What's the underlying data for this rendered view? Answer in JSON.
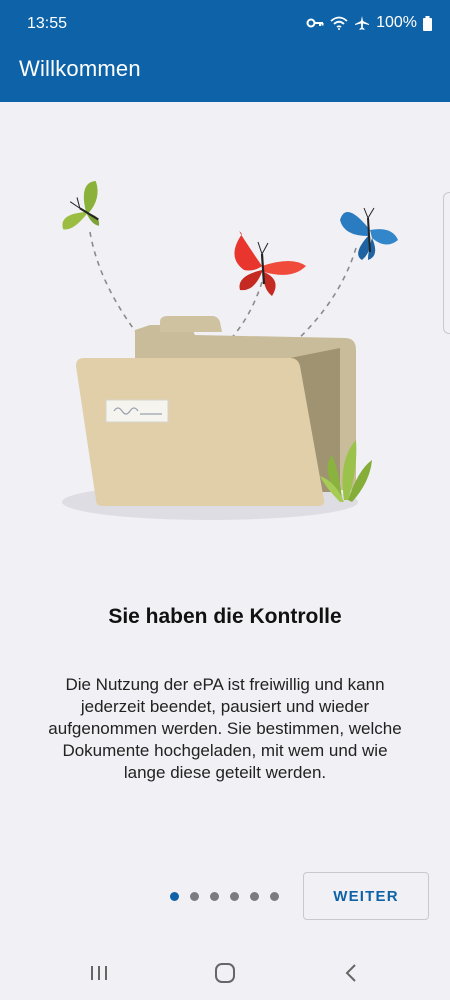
{
  "status_bar": {
    "time": "13:55",
    "battery": "100%",
    "icons": [
      "vpn-key-icon",
      "wifi-icon",
      "airplane-icon",
      "battery-icon"
    ]
  },
  "header": {
    "title": "Willkommen",
    "color": "#0e63a8"
  },
  "onboarding": {
    "illustration": "folder-with-butterflies",
    "headline": "Sie haben die Kontrolle",
    "body": "Die Nutzung der ePA ist freiwillig und kann jederzeit beendet, pausiert und wieder aufgenommen werden. Sie bestimmen, welche Dokumente hochgeladen, mit wem und wie lange diese geteilt werden.",
    "page_count": 6,
    "current_page": 1,
    "next_label": "WEITER"
  },
  "nav_bar": {
    "icons": [
      "recent-apps-icon",
      "home-icon",
      "back-icon"
    ]
  }
}
